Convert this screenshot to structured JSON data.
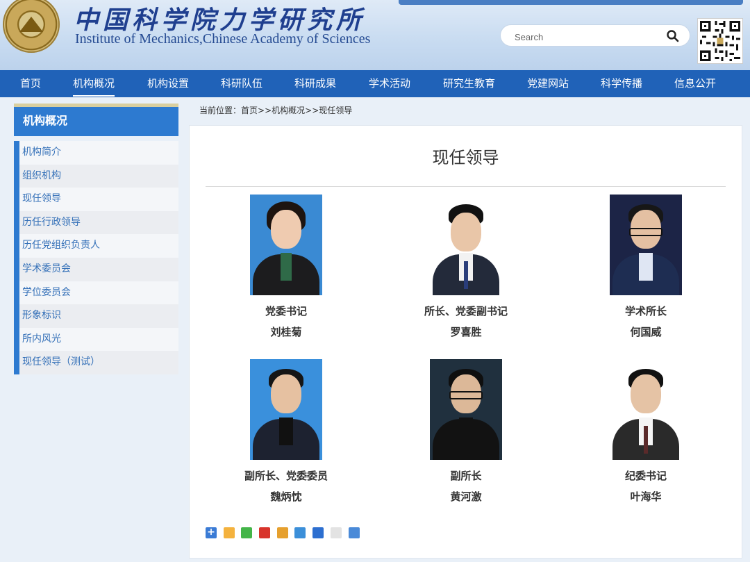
{
  "header": {
    "title_cn": "中国科学院力学研究所",
    "title_en": "Institute of Mechanics,Chinese Academy of Sciences",
    "search_placeholder": "Search"
  },
  "nav": {
    "items": [
      "首页",
      "机构概况",
      "机构设置",
      "科研队伍",
      "科研成果",
      "学术活动",
      "研究生教育",
      "党建网站",
      "科学传播",
      "信息公开"
    ],
    "active": "机构概况"
  },
  "sidebar": {
    "title": "机构概况",
    "items": [
      "机构简介",
      "组织机构",
      "现任领导",
      "历任行政领导",
      "历任党组织负责人",
      "学术委员会",
      "学位委员会",
      "形象标识",
      "所内风光",
      "现任领导（测试）"
    ]
  },
  "breadcrumb": {
    "prefix": "当前位置：",
    "home": "首页",
    "sep1": ">>",
    "section": "机构概况",
    "sep2": ">>",
    "current": "现任领导"
  },
  "content": {
    "title": "现任领导",
    "leaders": [
      {
        "role": "党委书记",
        "name": "刘桂菊"
      },
      {
        "role": "所长、党委副书记",
        "name": "罗喜胜"
      },
      {
        "role": "学术所长",
        "name": "何国威"
      },
      {
        "role": "副所长、党委委员",
        "name": "魏炳忱"
      },
      {
        "role": "副所长",
        "name": "黄河激"
      },
      {
        "role": "纪委书记",
        "name": "叶海华"
      }
    ]
  },
  "colors": {
    "nav_bg": "#2062b8",
    "sidebar_accent": "#2d7ad0",
    "link": "#3470b8"
  },
  "share_icons": [
    "share-plus-icon",
    "qzone-icon",
    "wechat-icon",
    "renren-icon",
    "weibo-icon",
    "tencent-icon",
    "baidu-icon",
    "copy-icon",
    "print-icon"
  ]
}
